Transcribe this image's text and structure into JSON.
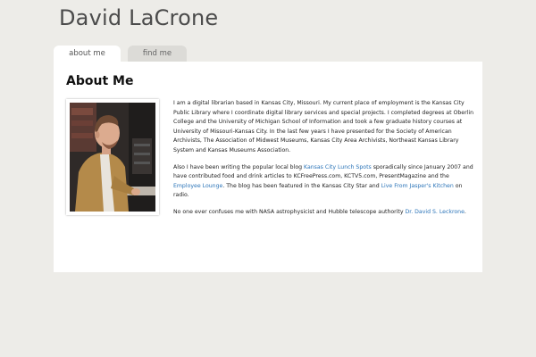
{
  "site": {
    "title": "David LaCrone"
  },
  "tabs": [
    {
      "label": "about me",
      "active": true
    },
    {
      "label": "find me",
      "active": false
    }
  ],
  "main": {
    "heading": "About Me",
    "photo_alt": "portrait photo of a man in a cardigan at a computer",
    "paragraph1": {
      "text": "I am a digital librarian based in Kansas City, Missouri. My current place of employment is the Kansas City Public Library where I coordinate digital library services and special projects. I completed degrees at Oberlin College and the University of Michigan School of Information and took a few graduate history courses at University of Missouri-Kansas City. In the last few years I have presented for the Society of American Archivists, The Association of Midwest Museums, Kansas City Area Archivists, Northeast Kansas Library System and Kansas Museums Association."
    },
    "paragraph2": {
      "t1": "Also I have been writing the popular local blog ",
      "link1": "Kansas City Lunch Spots",
      "t2": " sporadically since January 2007 and have contributed food and drink articles to KCFreePress.com, KCTV5.com, PresentMagazine and the ",
      "link2": "Employee Lounge",
      "t3": ".  The blog has been featured in the Kansas City Star and ",
      "link3": "Live From Jasper's Kitchen",
      "t4": " on radio."
    },
    "paragraph3": {
      "t1": "No one ever confuses me with NASA astrophysicist and Hubble telescope authority ",
      "link1": "Dr. David S. Leckrone",
      "t2": "."
    }
  },
  "colors": {
    "background": "#edece8",
    "panel": "#ffffff",
    "link": "#2b74b8",
    "inactive_tab": "#dcdbd7"
  }
}
